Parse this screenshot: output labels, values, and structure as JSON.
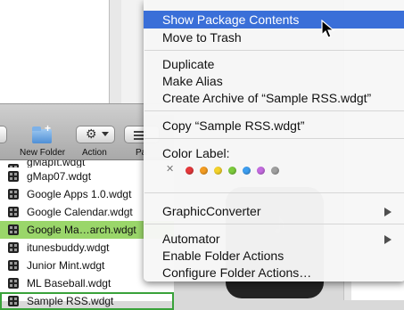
{
  "menu": {
    "items_top": [
      {
        "label": "Show Package Contents",
        "active": true
      },
      {
        "label": "Move to Trash",
        "active": false
      }
    ],
    "items_group2": [
      {
        "label": "Duplicate"
      },
      {
        "label": "Make Alias"
      },
      {
        "label": "Create Archive of “Sample RSS.wdgt”"
      }
    ],
    "copy_label": "Copy “Sample RSS.wdgt”",
    "color_label": "Color Label:",
    "color_dots": [
      "#e5383b",
      "#f39c22",
      "#f3d22b",
      "#7ccb3c",
      "#3d9ef0",
      "#c46be0",
      "#a0a0a0"
    ],
    "graphicconverter_label": "GraphicConverter",
    "automator_label": "Automator",
    "enable_folder_actions_label": "Enable Folder Actions",
    "configure_folder_actions_label": "Configure Folder Actions…"
  },
  "toolbar": {
    "new_folder_label": "New Folder",
    "action_label": "Action",
    "view_label": "Pa"
  },
  "files": [
    {
      "name": "gMapIt.wdgt",
      "state": "cut"
    },
    {
      "name": "gMap07.wdgt",
      "state": "normal"
    },
    {
      "name": "Google Apps 1.0.wdgt",
      "state": "normal"
    },
    {
      "name": "Google Calendar.wdgt",
      "state": "normal"
    },
    {
      "name": "Google Ma…arch.wdgt",
      "state": "highlight"
    },
    {
      "name": "itunesbuddy.wdgt",
      "state": "normal"
    },
    {
      "name": "Junior Mint.wdgt",
      "state": "normal"
    },
    {
      "name": "ML Baseball.wdgt",
      "state": "normal"
    },
    {
      "name": "Sample RSS.wdgt",
      "state": "selected"
    }
  ]
}
